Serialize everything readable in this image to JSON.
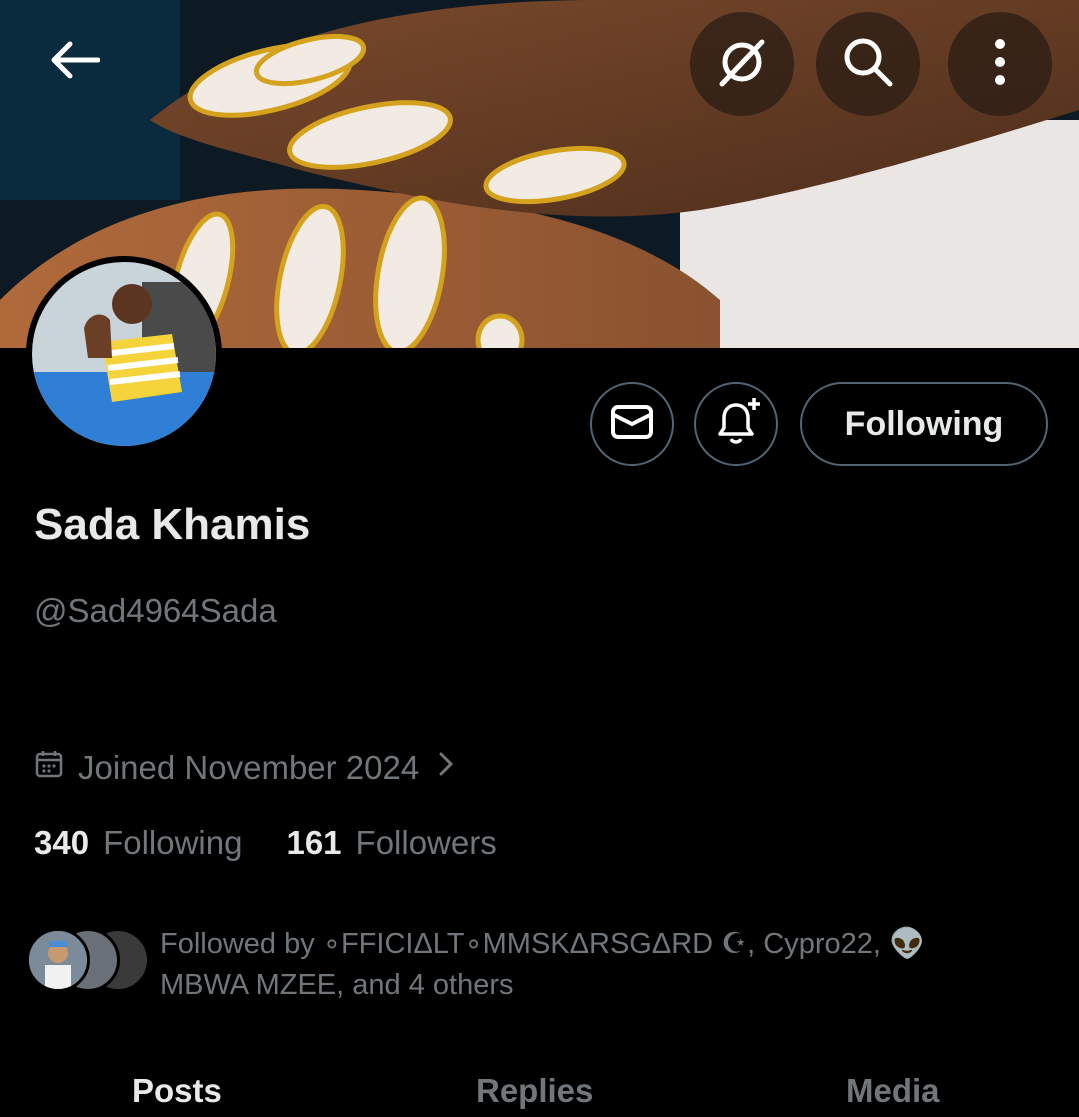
{
  "header": {
    "back_icon": "arrow-left-icon",
    "grok_icon": "grok-icon",
    "search_icon": "search-icon",
    "more_icon": "more-vertical-icon"
  },
  "profile": {
    "name": "Sada Khamis",
    "handle": "@Sad4964Sada",
    "joined": "Joined November 2024",
    "following_button": "Following"
  },
  "stats": {
    "following_count": "340",
    "following_label": "Following",
    "followers_count": "161",
    "followers_label": "Followers"
  },
  "followed_by": {
    "text": "Followed by ∘FFICIΔLT∘MMSKΔRSGΔRD ☪, Cypro22, 👽 MΒWA MZEE, and 4 others"
  },
  "tabs": [
    {
      "label": "Posts"
    },
    {
      "label": "Replies"
    },
    {
      "label": "Media"
    }
  ],
  "colors": {
    "background": "#000000",
    "text_primary": "#e7e9ea",
    "text_secondary": "#71767b",
    "border": "#536471"
  }
}
